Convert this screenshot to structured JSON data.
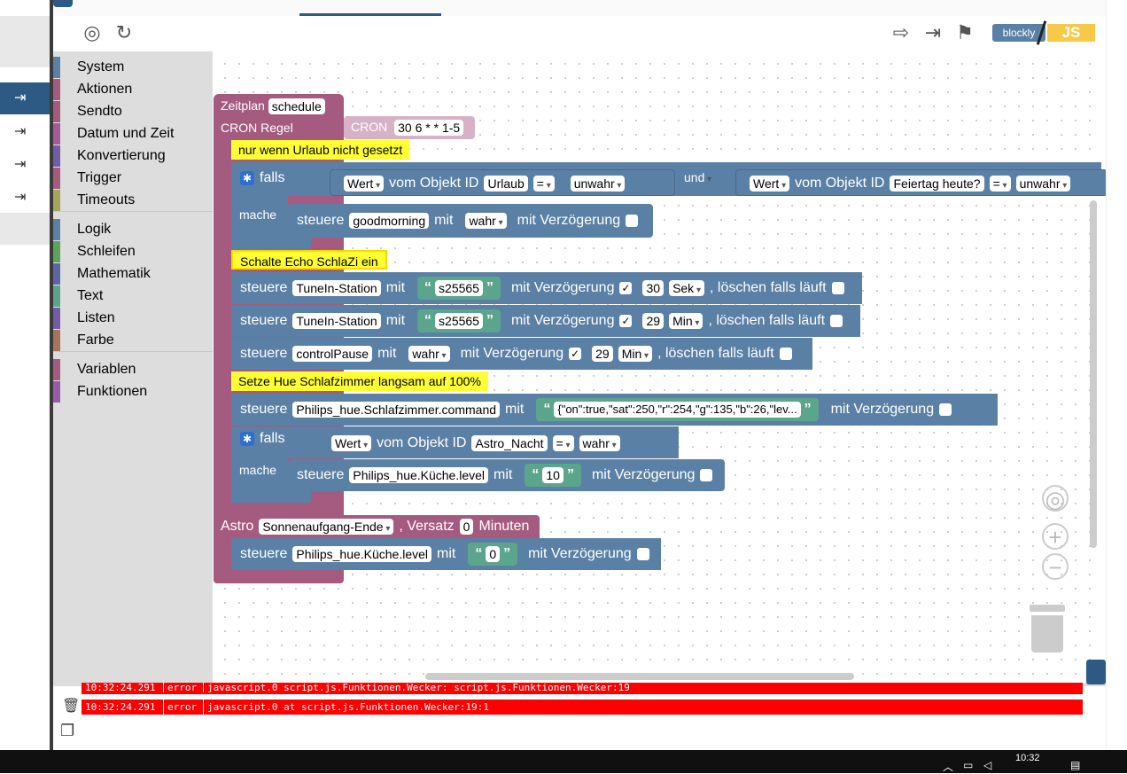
{
  "toolbox": {
    "categories": [
      {
        "label": "System",
        "color": "#5b80a5"
      },
      {
        "label": "Aktionen",
        "color": "#a55b80"
      },
      {
        "label": "Sendto",
        "color": "#a55b80"
      },
      {
        "label": "Datum und Zeit",
        "color": "#a55b99"
      },
      {
        "label": "Konvertierung",
        "color": "#745ba5"
      },
      {
        "label": "Trigger",
        "color": "#a55b80"
      },
      {
        "label": "Timeouts",
        "color": "#a5a55b"
      },
      {
        "label": "Logik",
        "color": "#5b80a5"
      },
      {
        "label": "Schleifen",
        "color": "#5ba55b"
      },
      {
        "label": "Mathematik",
        "color": "#5b67a5"
      },
      {
        "label": "Text",
        "color": "#5ba58c"
      },
      {
        "label": "Listen",
        "color": "#745ba5"
      },
      {
        "label": "Farbe",
        "color": "#a5745b"
      },
      {
        "label": "Variablen",
        "color": "#a55b80"
      },
      {
        "label": "Funktionen",
        "color": "#995ba5"
      }
    ]
  },
  "toolbar": {
    "blockly_label": "blockly",
    "js_label": "JS",
    "icons": [
      "locate-icon",
      "refresh-icon",
      "export-icon",
      "import-icon",
      "flag-icon"
    ]
  },
  "blocks": {
    "schedule": {
      "label": "Zeitplan",
      "name": "schedule"
    },
    "cron": {
      "label": "CRON Regel",
      "cron_label": "CRON",
      "expr": "30 6 * * 1-5"
    },
    "comment1": "nur wenn Urlaub nicht gesetzt",
    "if1": {
      "falls": "falls",
      "wert": "Wert",
      "vom": "vom Objekt ID",
      "obj1": "Urlaub",
      "op": "=",
      "val1": "unwahr",
      "und": "und",
      "obj2": "Feiertag heute?",
      "val2": "unwahr",
      "mache": "mache",
      "steuere": "steuere",
      "target": "goodmorning",
      "mit": "mit",
      "value": "wahr",
      "delay": "mit Verzögerung"
    },
    "comment2": "Schalte Echo SchlaZi ein",
    "ctl1": {
      "steuere": "steuere",
      "target": "TuneIn-Station",
      "mit": "mit",
      "text": "s25565",
      "delay": "mit Verzögerung",
      "checked": "✓",
      "num": "30",
      "unit": "Sek",
      "clear": ", löschen falls läuft"
    },
    "ctl2": {
      "steuere": "steuere",
      "target": "TuneIn-Station",
      "mit": "mit",
      "text": "s25565",
      "delay": "mit Verzögerung",
      "checked": "✓",
      "num": "29",
      "unit": "Min",
      "clear": ", löschen falls läuft"
    },
    "ctl3": {
      "steuere": "steuere",
      "target": "controlPause",
      "mit": "mit",
      "value": "wahr",
      "delay": "mit Verzögerung",
      "checked": "✓",
      "num": "29",
      "unit": "Min",
      "clear": ", löschen falls läuft"
    },
    "comment3": "Setze Hue Schlafzimmer langsam auf 100%",
    "ctl4": {
      "steuere": "steuere",
      "target": "Philips_hue.Schlafzimmer.command",
      "mit": "mit",
      "text": "{\"on\":true,\"sat\":250,\"r\":254,\"g\":135,\"b\":26,\"lev...",
      "delay": "mit Verzögerung"
    },
    "if2": {
      "falls": "falls",
      "wert": "Wert",
      "vom": "vom Objekt ID",
      "obj": "Astro_Nacht",
      "op": "=",
      "val": "wahr",
      "mache": "mache",
      "steuere": "steuere",
      "target": "Philips_hue.Küche.level",
      "mit": "mit",
      "text": "10",
      "delay": "mit Verzögerung"
    },
    "astro": {
      "label": "Astro",
      "event": "Sonnenaufgang-Ende",
      "versatz": ", Versatz",
      "offset": "0",
      "minuten": "Minuten"
    },
    "ctl5": {
      "steuere": "steuere",
      "target": "Philips_hue.Küche.level",
      "mit": "mit",
      "text": "0",
      "delay": "mit Verzögerung"
    }
  },
  "log": [
    {
      "time": "10:32:24.291",
      "severity": "error",
      "message": "javascript.0 script.js.Funktionen.Wecker: script.js.Funktionen.Wecker:19"
    },
    {
      "time": "10:32:24.291",
      "severity": "error",
      "message": "javascript.0 at script.js.Funktionen.Wecker:19:1"
    }
  ],
  "taskbar": {
    "time": "10:32"
  },
  "colors": {
    "accent": "#2d5a84",
    "logic": "#5b80a5",
    "trigger": "#a55b80",
    "text": "#5ba58c",
    "comment": "#ffff33",
    "error": "#ff0000"
  }
}
